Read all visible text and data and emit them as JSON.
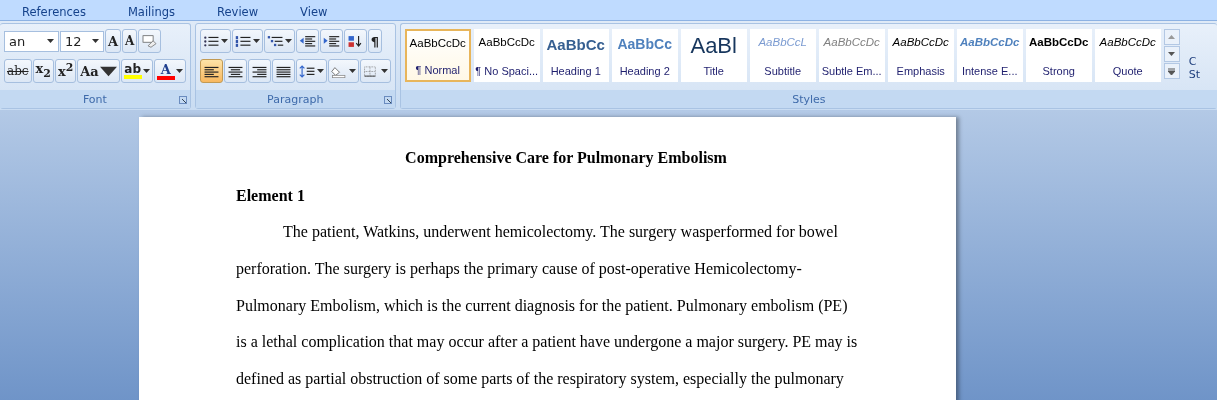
{
  "tabs": [
    {
      "label": "References",
      "selected": false
    },
    {
      "label": "Mailings",
      "selected": false
    },
    {
      "label": "Review",
      "selected": false
    },
    {
      "label": "View",
      "selected": false
    }
  ],
  "font": {
    "label": "Font",
    "name": "an",
    "size": "12",
    "row1": [
      {
        "kind": "grow",
        "glyph": "A"
      },
      {
        "kind": "shrink",
        "glyph": "A"
      },
      {
        "kind": "clear"
      }
    ],
    "row2": [
      {
        "kind": "strike",
        "glyph": "abc"
      },
      {
        "kind": "sub",
        "glyph": "x$_{2}$"
      },
      {
        "kind": "sup",
        "glyph": "x$^{2}$"
      },
      {
        "kind": "case",
        "glyph": "Aa"
      },
      {
        "kind": "highlight",
        "glyph": "ab",
        "color": "#ffff00"
      },
      {
        "kind": "fontcolor",
        "glyph": "A",
        "color": "#ff0000"
      }
    ]
  },
  "paragraph": {
    "label": "Paragraph",
    "row1": [
      {
        "kind": "bullets"
      },
      {
        "kind": "numbering"
      },
      {
        "kind": "multilevel"
      },
      {
        "kind": "outdent"
      },
      {
        "kind": "indent"
      },
      {
        "kind": "sort"
      },
      {
        "kind": "pilcrow",
        "glyph": "¶"
      }
    ],
    "alignments": [
      {
        "kind": "left",
        "selected": true
      },
      {
        "kind": "center",
        "selected": false
      },
      {
        "kind": "right",
        "selected": false
      },
      {
        "kind": "justify",
        "selected": false
      }
    ],
    "row2": [
      {
        "kind": "spacing"
      },
      {
        "kind": "shading"
      },
      {
        "kind": "borders"
      }
    ]
  },
  "styles": {
    "label": "Styles",
    "change_label": [
      "C",
      "St"
    ],
    "items": [
      {
        "sample": "AaBbCcDc",
        "label": "¶ Normal",
        "kind": "normal",
        "selected": true
      },
      {
        "sample": "AaBbCcDc",
        "label": "¶ No Spaci...",
        "kind": "normal",
        "selected": false
      },
      {
        "sample": "AaBbCc",
        "label": "Heading 1",
        "kind": "heading1",
        "selected": false
      },
      {
        "sample": "AaBbCc",
        "label": "Heading 2",
        "kind": "heading2",
        "selected": false
      },
      {
        "sample": "AaBl",
        "label": "Title",
        "kind": "title",
        "selected": false
      },
      {
        "sample": "AaBbCcL",
        "label": "Subtitle",
        "kind": "subtitle",
        "selected": false
      },
      {
        "sample": "AaBbCcDc",
        "label": "Subtle Em...",
        "kind": "subtle",
        "selected": false
      },
      {
        "sample": "AaBbCcDc",
        "label": "Emphasis",
        "kind": "emphasis",
        "selected": false
      },
      {
        "sample": "AaBbCcDc",
        "label": "Intense E...",
        "kind": "intense",
        "selected": false
      },
      {
        "sample": "AaBbCcDc",
        "label": "Strong",
        "kind": "strong",
        "selected": false
      },
      {
        "sample": "AaBbCcDc",
        "label": "Quote",
        "kind": "quote",
        "selected": false
      }
    ]
  },
  "document": {
    "title": "Comprehensive Care for Pulmonary Embolism",
    "heading": "Element 1",
    "paragraph_lines": [
      "The patient, Watkins, underwent hemicolectomy. The surgery wasperformed for bowel",
      "perforation. The surgery is perhaps the primary cause of post-operative Hemicolectomy-",
      "Pulmonary Embolism, which is the current diagnosis for the patient. Pulmonary embolism (PE)",
      "is a lethal complication that may occur after a patient have undergone a major surgery. PE may is",
      "defined as partial obstruction of some parts of the respiratory system, especially the pulmonary"
    ]
  }
}
